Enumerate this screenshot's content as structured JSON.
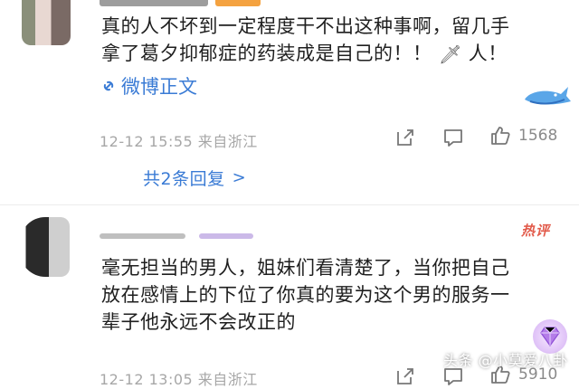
{
  "comments": [
    {
      "text_lines": [
        "真的人不坏到一定程度干不出这种事啊，留几手",
        "拿了葛夕抑郁症的药装成是自己的！！"
      ],
      "text_end": "人！",
      "sword_glyph": "🗡",
      "weibo_link": "微博正文",
      "meta": "12-12 15:55 来自浙江",
      "like_count": "1568",
      "replies_label": "共2条回复",
      "replies_chevron": ">"
    },
    {
      "hot_badge": "热评",
      "text_lines": [
        "毫无担当的男人，姐妹们看清楚了，当你把自己",
        "放在感情上的下位了你真的要为这个男的服务一",
        "辈子他永远不会改正的"
      ],
      "meta": "12-12 13:05 来自浙江",
      "like_count": "5910"
    }
  ],
  "watermark": "头条 @小莫爱八卦",
  "colors": {
    "link": "#3a7bd5",
    "meta": "#a7a7a7",
    "hot": "#e25b4b"
  },
  "icons": [
    "link-icon",
    "share-icon",
    "comment-icon",
    "like-icon",
    "whale-icon",
    "diamond-icon"
  ]
}
